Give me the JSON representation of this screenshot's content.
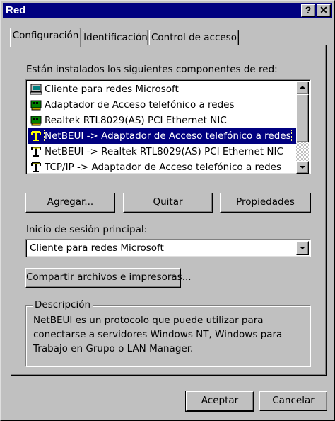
{
  "window": {
    "title": "Red",
    "help_glyph": "?",
    "close_glyph": "✕",
    "title_color": "#000080"
  },
  "tabs": [
    {
      "label": "Configuración",
      "active": true
    },
    {
      "label": "Identificación",
      "active": false
    },
    {
      "label": "Control de acceso",
      "active": false
    }
  ],
  "components": {
    "label": "Están instalados los siguientes componentes de red:",
    "items": [
      {
        "icon": "computer-icon",
        "label": "Cliente para redes Microsoft",
        "selected": false
      },
      {
        "icon": "network-adapter-icon",
        "label": "Adaptador de Acceso telefónico a redes",
        "selected": false
      },
      {
        "icon": "network-adapter-icon",
        "label": "Realtek RTL8029(AS) PCI Ethernet NIC",
        "selected": false
      },
      {
        "icon": "protocol-icon",
        "label": "NetBEUI -> Adaptador de Acceso telefónico a redes",
        "selected": true
      },
      {
        "icon": "protocol-icon",
        "label": "NetBEUI -> Realtek RTL8029(AS) PCI Ethernet NIC",
        "selected": false
      },
      {
        "icon": "protocol-icon",
        "label": "TCP/IP -> Adaptador de Acceso telefónico a redes",
        "selected": false
      }
    ]
  },
  "buttons": {
    "add": "Agregar...",
    "remove": "Quitar",
    "properties": "Propiedades",
    "share": "Compartir archivos e impresoras...",
    "ok": "Aceptar",
    "cancel": "Cancelar"
  },
  "logon": {
    "label": "Inicio de sesión principal:",
    "selected": "Cliente para redes Microsoft"
  },
  "description": {
    "title": "Descripción",
    "text": "NetBEUI es un protocolo que puede utilizar para conectarse a servidores Windows NT, Windows para Trabajo en Grupo o LAN Manager."
  }
}
